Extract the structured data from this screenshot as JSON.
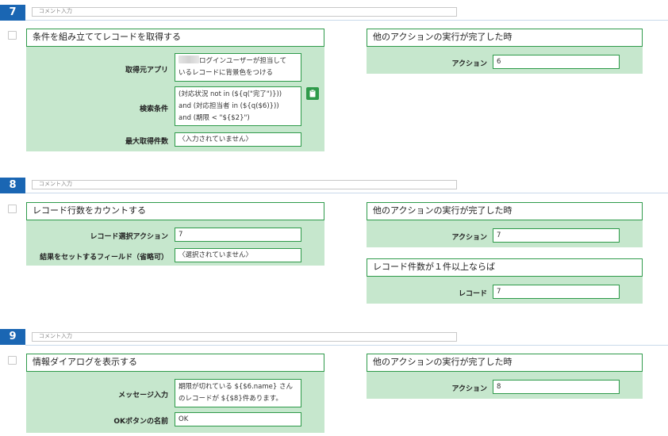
{
  "steps": [
    {
      "number": "7",
      "comment_placeholder": "コメント入力",
      "main_action": {
        "title": "条件を組み立ててレコードを取得する",
        "fields": [
          {
            "label": "取得元アプリ",
            "value_lines": [
              "ログインユーザーが担当して",
              "いるレコードに背景色をつける"
            ]
          },
          {
            "label": "検索条件",
            "value_lines": [
              "(対応状況 not in (${q(\"完了\")}))",
              "and (対応担当者 in (${q($6)}))",
              "and (期限 < \"${$2}\")"
            ]
          },
          {
            "label": "最大取得件数",
            "value": "〈入力されていません〉"
          }
        ]
      },
      "conditions": [
        {
          "title": "他のアクションの実行が完了した時",
          "label": "アクション",
          "value": "6"
        }
      ]
    },
    {
      "number": "8",
      "comment_placeholder": "コメント入力",
      "main_action": {
        "title": "レコード行数をカウントする",
        "fields": [
          {
            "label": "レコード選択アクション",
            "value": "7"
          },
          {
            "label": "結果をセットするフィールド（省略可）",
            "value": "〈選択されていません〉"
          }
        ]
      },
      "conditions": [
        {
          "title": "他のアクションの実行が完了した時",
          "label": "アクション",
          "value": "7"
        },
        {
          "title": "レコード件数が１件以上ならば",
          "label": "レコード",
          "value": "7"
        }
      ]
    },
    {
      "number": "9",
      "comment_placeholder": "コメント入力",
      "main_action": {
        "title": "情報ダイアログを表示する",
        "fields": [
          {
            "label": "メッセージ入力",
            "value_lines": [
              "期限が切れている ${$6.name} さん",
              "のレコードが ${$8}件あります。"
            ]
          },
          {
            "label": "OKボタンの名前",
            "value": "OK"
          }
        ]
      },
      "conditions": [
        {
          "title": "他のアクションの実行が完了した時",
          "label": "アクション",
          "value": "8"
        }
      ]
    }
  ],
  "icons": {
    "copy": "clipboard-icon",
    "redacted": "redacted-icon"
  },
  "colors": {
    "step_badge": "#1a66b3",
    "panel_bg": "#c6e7cd",
    "panel_border": "#2e9a4a"
  }
}
